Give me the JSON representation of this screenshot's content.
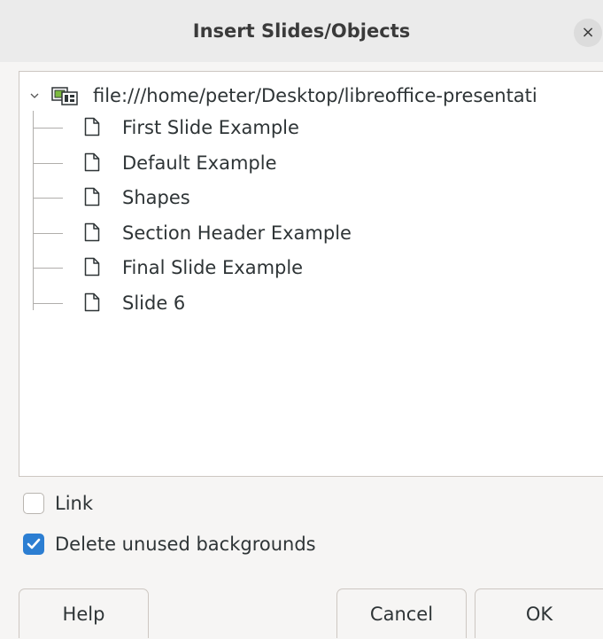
{
  "dialog": {
    "title": "Insert Slides/Objects",
    "close_label": "×"
  },
  "tree": {
    "root": {
      "label": "file:///home/peter/Desktop/libreoffice-presentati",
      "icon": "presentation-file-icon",
      "expanded": true
    },
    "items": [
      {
        "label": "First Slide Example",
        "icon": "page-icon"
      },
      {
        "label": "Default Example",
        "icon": "page-icon"
      },
      {
        "label": "Shapes",
        "icon": "page-icon"
      },
      {
        "label": "Section Header Example",
        "icon": "page-icon"
      },
      {
        "label": "Final Slide Example",
        "icon": "page-icon"
      },
      {
        "label": "Slide 6",
        "icon": "page-icon"
      }
    ]
  },
  "options": {
    "link": {
      "label": "Link",
      "checked": false
    },
    "delete_unused_backgrounds": {
      "label": "Delete unused backgrounds",
      "checked": true
    }
  },
  "buttons": {
    "help": "Help",
    "cancel": "Cancel",
    "ok": "OK"
  },
  "colors": {
    "accent": "#2c7ed2",
    "titlebar": "#ebebeb",
    "background": "#f6f5f4"
  }
}
